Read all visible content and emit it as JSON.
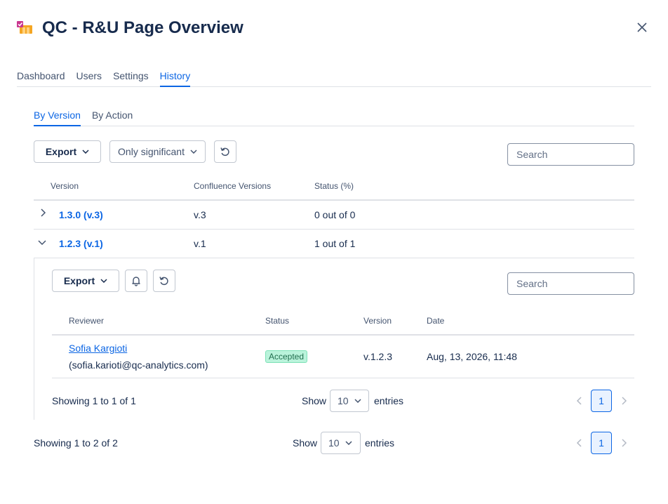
{
  "header": {
    "title": "QC - R&U Page Overview",
    "icon": "app-icon",
    "close_icon": "close-icon"
  },
  "main_tabs": [
    {
      "label": "Dashboard",
      "active": false
    },
    {
      "label": "Users",
      "active": false
    },
    {
      "label": "Settings",
      "active": false
    },
    {
      "label": "History",
      "active": true
    }
  ],
  "sub_tabs": [
    {
      "label": "By Version",
      "active": true
    },
    {
      "label": "By Action",
      "active": false
    }
  ],
  "toolbar": {
    "export_label": "Export",
    "filter_label": "Only significant",
    "search_placeholder": "Search"
  },
  "versions_table": {
    "columns": [
      "Version",
      "Confluence Versions",
      "Status (%)"
    ],
    "rows": [
      {
        "version": "1.3.0 (v.3)",
        "confluence": "v.3",
        "status": "0 out of 0",
        "expanded": false
      },
      {
        "version": "1.2.3 (v.1)",
        "confluence": "v.1",
        "status": "1 out of 1",
        "expanded": true
      }
    ]
  },
  "nested": {
    "export_label": "Export",
    "search_placeholder": "Search",
    "columns": [
      "Reviewer",
      "Status",
      "Version",
      "Date"
    ],
    "rows": [
      {
        "reviewer_name": "Sofia Kargioti",
        "reviewer_email": "(sofia.karioti@qc-analytics.com)",
        "status": "Accepted",
        "version": "v.1.2.3",
        "date": "Aug, 13, 2026, 11:48"
      }
    ],
    "footer": {
      "showing": "Showing 1 to 1 of 1",
      "show_label": "Show",
      "page_size": "10",
      "entries_label": "entries",
      "current_page": "1"
    }
  },
  "footer": {
    "showing": "Showing 1 to 2 of 2",
    "show_label": "Show",
    "page_size": "10",
    "entries_label": "entries",
    "current_page": "1"
  },
  "colors": {
    "accent": "#0c66e4",
    "badge_bg": "#baf3db",
    "badge_text": "#216e4e"
  }
}
